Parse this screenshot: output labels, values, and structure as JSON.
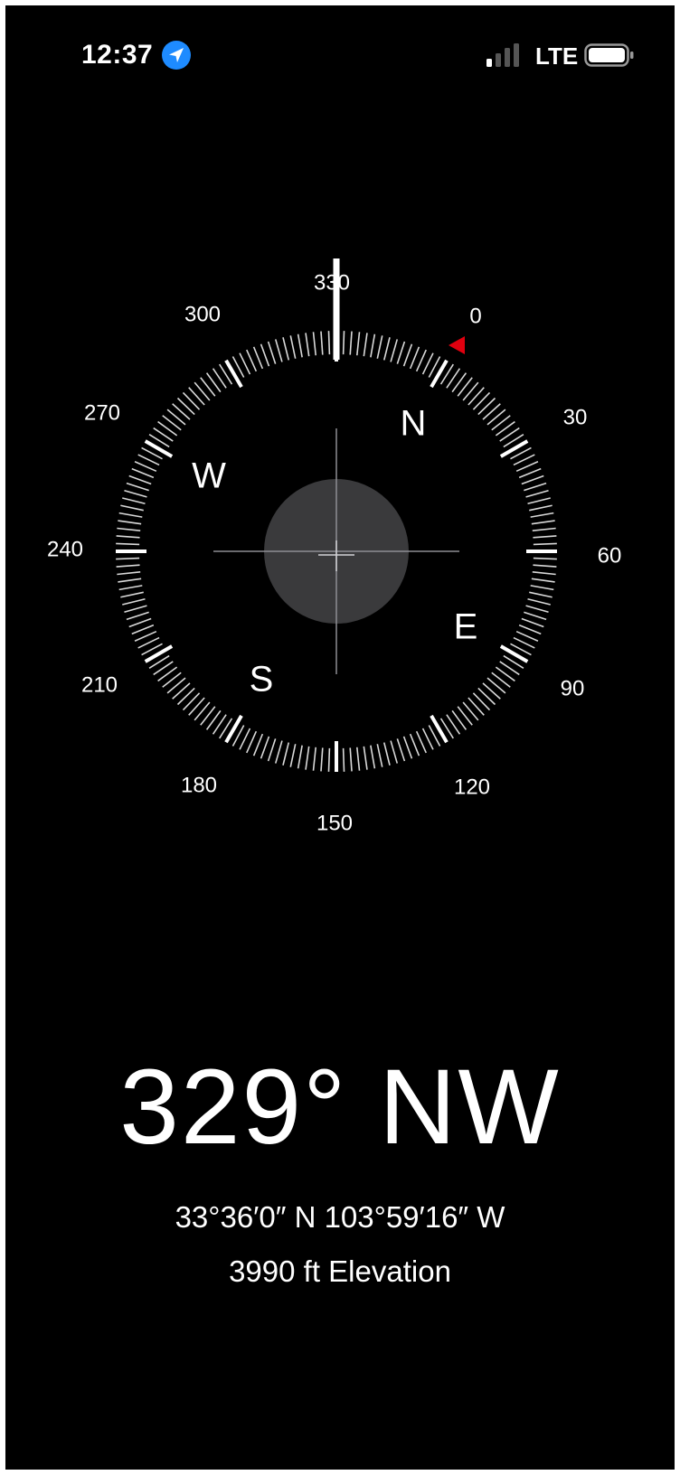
{
  "status_bar": {
    "time": "12:37",
    "network": "LTE",
    "location_icon": "location-arrow-icon",
    "signal_icon": "cellular-signal-icon",
    "battery_icon": "battery-icon"
  },
  "compass": {
    "degree_labels": [
      "330",
      "0",
      "30",
      "60",
      "90",
      "120",
      "150",
      "180",
      "210",
      "240",
      "270",
      "300"
    ],
    "cardinals": [
      "N",
      "E",
      "S",
      "W"
    ],
    "accent_color": "#e0000f"
  },
  "readout": {
    "heading": "329° NW",
    "coordinates": "33°36′0″ N  103°59′16″ W",
    "elevation": "3990 ft Elevation"
  }
}
